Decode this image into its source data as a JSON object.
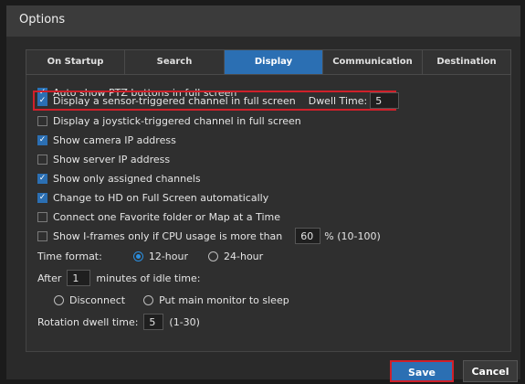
{
  "window": {
    "title": "Options"
  },
  "tabs": [
    {
      "label": "On Startup",
      "active": false
    },
    {
      "label": "Search",
      "active": false
    },
    {
      "label": "Display",
      "active": true
    },
    {
      "label": "Communication",
      "active": false
    },
    {
      "label": "Destination",
      "active": false
    }
  ],
  "options": {
    "auto_ptz": {
      "label": "Auto show PTZ buttons in full screen",
      "checked": true
    },
    "sensor_triggered": {
      "label": "Display a sensor-triggered channel in full screen",
      "checked": true,
      "dwell_label": "Dwell Time:",
      "dwell_value": "5"
    },
    "joystick_triggered": {
      "label": "Display a joystick-triggered channel in full screen",
      "checked": false
    },
    "camera_ip": {
      "label": "Show camera IP address",
      "checked": true
    },
    "server_ip": {
      "label": "Show server IP address",
      "checked": false
    },
    "assigned_channels": {
      "label": "Show only assigned channels",
      "checked": true
    },
    "hd_fullscreen": {
      "label": "Change to HD on Full Screen automatically",
      "checked": true
    },
    "favorite_folder": {
      "label": "Connect one Favorite folder or Map at a Time",
      "checked": false
    },
    "iframes": {
      "label": "Show I-frames only if CPU usage is more than",
      "checked": false,
      "value": "60",
      "suffix": "% (10-100)"
    }
  },
  "time_format": {
    "label": "Time format:",
    "option_12": "12-hour",
    "option_24": "24-hour",
    "selected": "12-hour"
  },
  "idle": {
    "prefix": "After",
    "value": "1",
    "suffix": "minutes of idle time:",
    "option_disconnect": "Disconnect",
    "option_sleep": "Put main monitor to sleep"
  },
  "rotation": {
    "label": "Rotation dwell time:",
    "value": "5",
    "range": "(1-30)"
  },
  "buttons": {
    "save": "Save",
    "cancel": "Cancel"
  },
  "colors": {
    "accent": "#2b6fb3",
    "highlight": "#d0202a",
    "radio": "#2b8fe0"
  }
}
